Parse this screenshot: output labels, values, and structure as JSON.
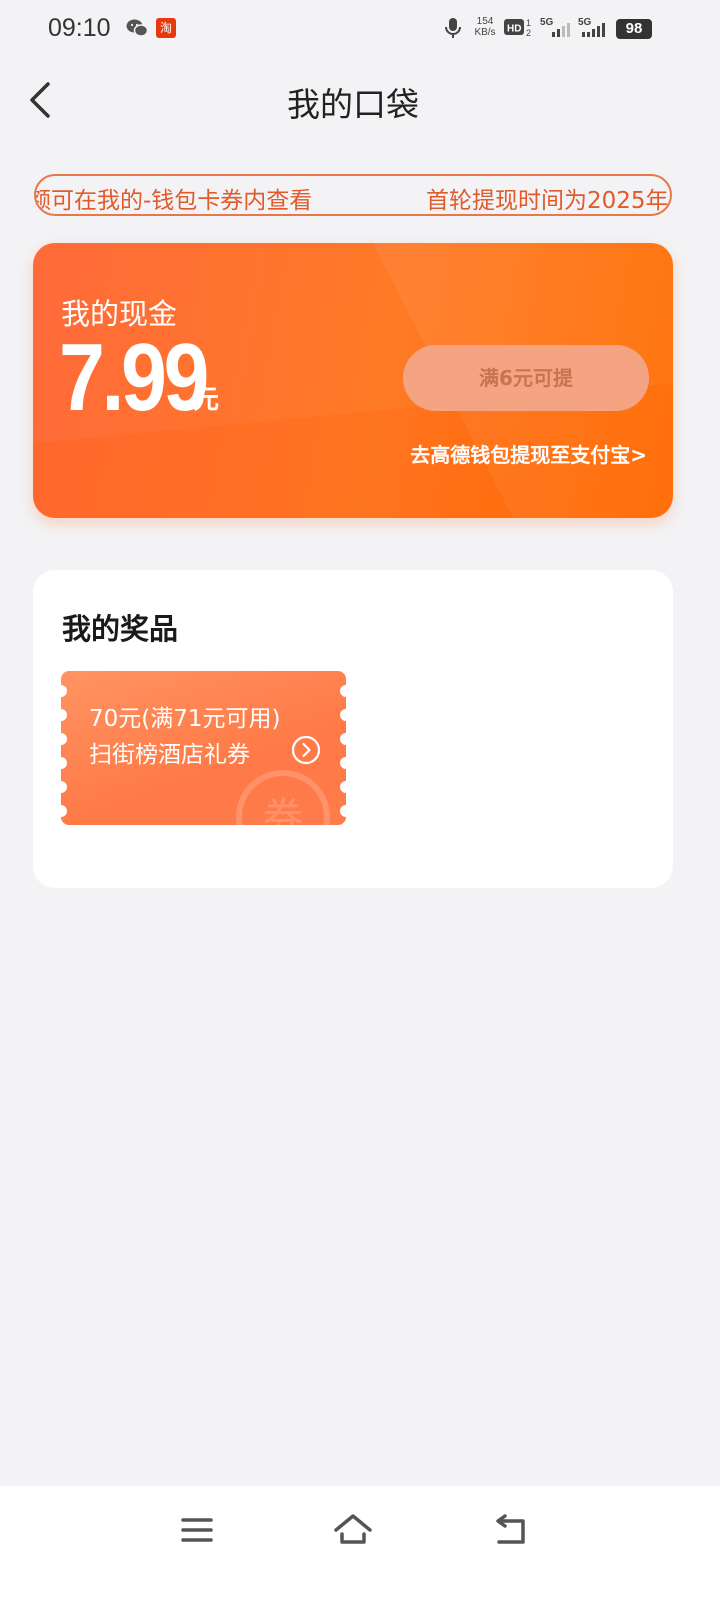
{
  "status_bar": {
    "time": "09:10",
    "net_speed_value": "154",
    "net_speed_unit": "KB/s",
    "battery": "98",
    "icons": [
      "wechat-icon",
      "taobao-icon",
      "mic-icon",
      "hd-icon",
      "signal-5g-icon",
      "signal-5g-icon",
      "battery-icon"
    ]
  },
  "header": {
    "title": "我的口袋",
    "back_icon": "chevron-left-icon"
  },
  "notice": {
    "text_a": "额可在我的-钱包卡券内查看",
    "text_b": "首轮提现时间为2025年"
  },
  "cash_card": {
    "label": "我的现金",
    "amount": "7.99",
    "unit": "元",
    "withdraw_button": "满6元可提",
    "alipay_link": "去高德钱包提现至支付宝>"
  },
  "prizes": {
    "title": "我的奖品",
    "coupons": [
      {
        "line1": "70元(满71元可用)",
        "line2": "扫街榜酒店礼券",
        "watermark": "券"
      }
    ]
  },
  "nav_bar": {
    "icons": [
      "menu-icon",
      "home-icon",
      "back-icon"
    ]
  },
  "colors": {
    "accent": "#ff6d00",
    "notice_text": "#e05a2a",
    "background": "#f3f3f5"
  }
}
